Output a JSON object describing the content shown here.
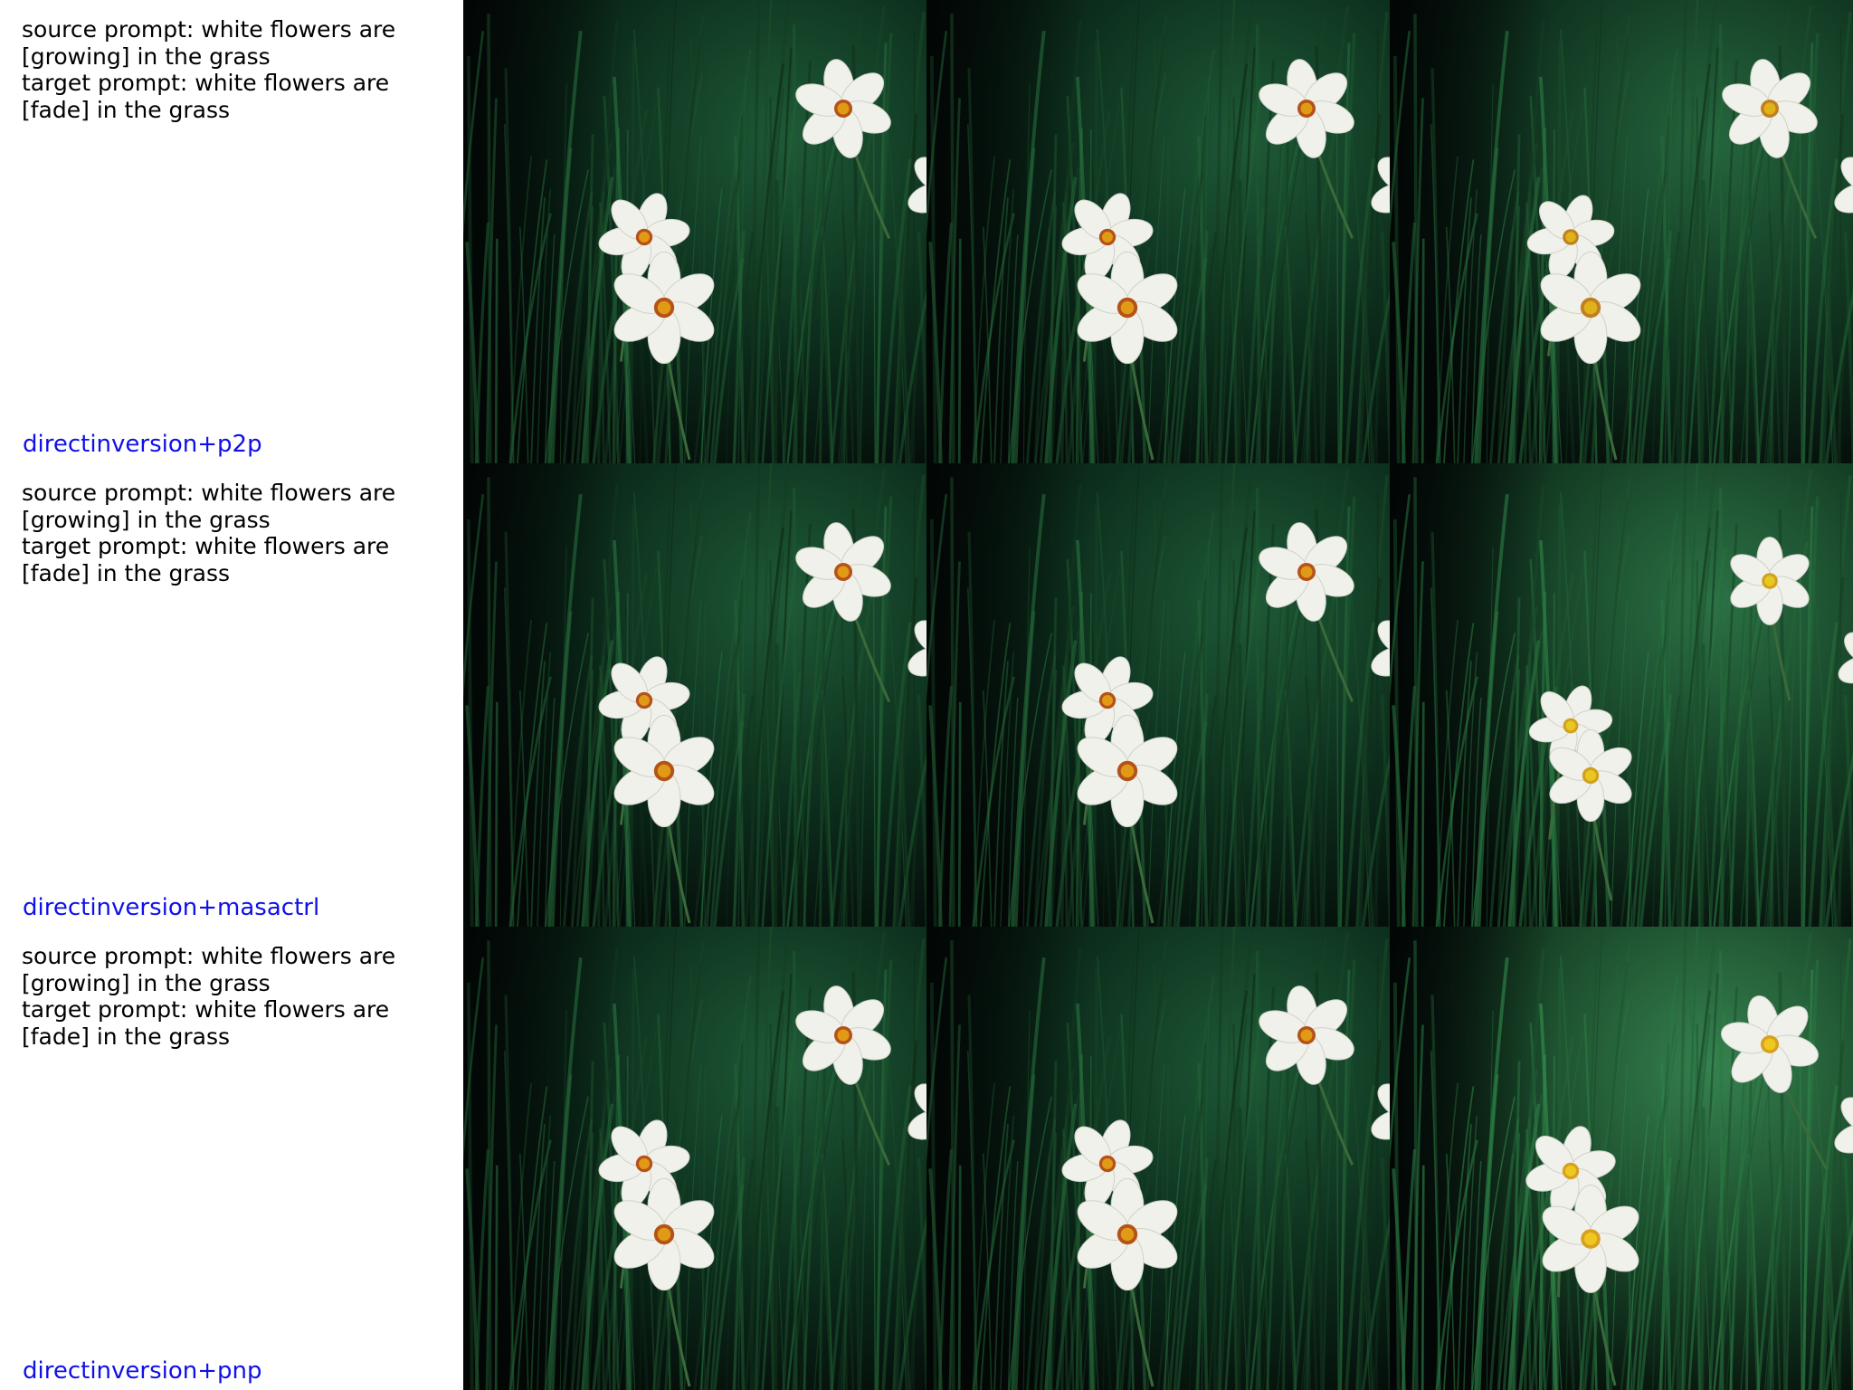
{
  "rows": [
    {
      "source_prompt_line1": "source prompt: white flowers are",
      "source_prompt_line2": "[growing] in the grass",
      "target_prompt_line1": "target prompt: white flowers are",
      "target_prompt_line2": "[fade] in the grass",
      "method": "directinversion+p2p"
    },
    {
      "source_prompt_line1": "source prompt: white flowers are",
      "source_prompt_line2": "[growing] in the grass",
      "target_prompt_line1": "target prompt: white flowers are",
      "target_prompt_line2": "[fade] in the grass",
      "method": "directinversion+masactrl"
    },
    {
      "source_prompt_line1": "source prompt: white flowers are",
      "source_prompt_line2": "[growing] in the grass",
      "target_prompt_line1": "target prompt: white flowers are",
      "target_prompt_line2": "[fade] in the grass",
      "method": "directinversion+pnp"
    }
  ],
  "colors": {
    "method_label": "#1010e8",
    "background_dark": "#050d0a",
    "grass": "#1c4a2c",
    "petal": "#f2f2ee",
    "flower_center": "#e6a21a"
  }
}
